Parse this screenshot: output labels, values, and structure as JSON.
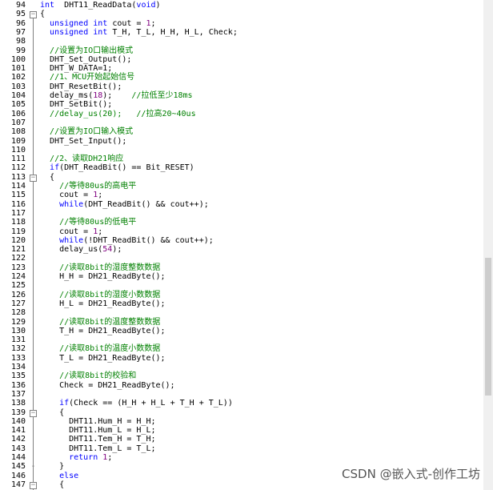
{
  "watermark": "CSDN @嵌入式-创作工坊",
  "lines": [
    {
      "n": "94",
      "fold": "",
      "t": [
        [
          "kw",
          "int"
        ],
        [
          "",
          "  DHT11_ReadData("
        ],
        [
          "kw",
          "void"
        ],
        [
          "",
          ")"
        ]
      ]
    },
    {
      "n": "95",
      "fold": "⊟",
      "t": [
        [
          "",
          "{"
        ]
      ]
    },
    {
      "n": "96",
      "fold": "",
      "t": [
        [
          "",
          "  "
        ],
        [
          "kw",
          "unsigned int"
        ],
        [
          "",
          " cout = "
        ],
        [
          "num",
          "1"
        ],
        [
          "",
          ";"
        ]
      ]
    },
    {
      "n": "97",
      "fold": "",
      "t": [
        [
          "",
          "  "
        ],
        [
          "kw",
          "unsigned int"
        ],
        [
          "",
          " T_H, T_L, H_H, H_L, Check;"
        ]
      ]
    },
    {
      "n": "98",
      "fold": "",
      "t": []
    },
    {
      "n": "99",
      "fold": "",
      "t": [
        [
          "",
          "  "
        ],
        [
          "cm",
          "//设置为IO口输出模式"
        ]
      ]
    },
    {
      "n": "100",
      "fold": "",
      "t": [
        [
          "",
          "  DHT_Set_Output();"
        ]
      ]
    },
    {
      "n": "101",
      "fold": "",
      "t": [
        [
          "",
          "  DHT_W_DATA=1;"
        ]
      ]
    },
    {
      "n": "102",
      "fold": "",
      "t": [
        [
          "",
          "  "
        ],
        [
          "cm",
          "//1、MCU开始起始信号"
        ]
      ]
    },
    {
      "n": "103",
      "fold": "",
      "t": [
        [
          "",
          "  DHT_ResetBit();"
        ]
      ]
    },
    {
      "n": "104",
      "fold": "",
      "t": [
        [
          "",
          "  delay_ms("
        ],
        [
          "num",
          "18"
        ],
        [
          "",
          ");    "
        ],
        [
          "cm",
          "//拉低至少18ms"
        ]
      ]
    },
    {
      "n": "105",
      "fold": "",
      "t": [
        [
          "",
          "  DHT_SetBit();"
        ]
      ]
    },
    {
      "n": "106",
      "fold": "",
      "t": [
        [
          "",
          "  "
        ],
        [
          "cm",
          "//delay_us(20);   //拉高20~40us"
        ]
      ]
    },
    {
      "n": "107",
      "fold": "",
      "t": []
    },
    {
      "n": "108",
      "fold": "",
      "t": [
        [
          "",
          "  "
        ],
        [
          "cm",
          "//设置为IO口输入模式"
        ]
      ]
    },
    {
      "n": "109",
      "fold": "",
      "t": [
        [
          "",
          "  DHT_Set_Input();"
        ]
      ]
    },
    {
      "n": "110",
      "fold": "",
      "t": []
    },
    {
      "n": "111",
      "fold": "",
      "t": [
        [
          "",
          "  "
        ],
        [
          "cm",
          "//2、读取DH21响应"
        ]
      ]
    },
    {
      "n": "112",
      "fold": "",
      "t": [
        [
          "",
          "  "
        ],
        [
          "kw",
          "if"
        ],
        [
          "",
          "(DHT_ReadBit() == Bit_RESET)"
        ]
      ]
    },
    {
      "n": "113",
      "fold": "⊟",
      "t": [
        [
          "",
          "  {"
        ]
      ]
    },
    {
      "n": "114",
      "fold": "",
      "t": [
        [
          "",
          "    "
        ],
        [
          "cm",
          "//等待80us的高电平"
        ]
      ]
    },
    {
      "n": "115",
      "fold": "",
      "t": [
        [
          "",
          "    cout = "
        ],
        [
          "num",
          "1"
        ],
        [
          "",
          ";"
        ]
      ]
    },
    {
      "n": "116",
      "fold": "",
      "t": [
        [
          "",
          "    "
        ],
        [
          "kw",
          "while"
        ],
        [
          "",
          "(DHT_ReadBit() && cout++);"
        ]
      ]
    },
    {
      "n": "117",
      "fold": "",
      "t": []
    },
    {
      "n": "118",
      "fold": "",
      "t": [
        [
          "",
          "    "
        ],
        [
          "cm",
          "//等待80us的低电平"
        ]
      ]
    },
    {
      "n": "119",
      "fold": "",
      "t": [
        [
          "",
          "    cout = "
        ],
        [
          "num",
          "1"
        ],
        [
          "",
          ";"
        ]
      ]
    },
    {
      "n": "120",
      "fold": "",
      "t": [
        [
          "",
          "    "
        ],
        [
          "kw",
          "while"
        ],
        [
          "",
          "(!DHT_ReadBit() && cout++);"
        ]
      ]
    },
    {
      "n": "121",
      "fold": "",
      "t": [
        [
          "",
          "    delay_us("
        ],
        [
          "num",
          "54"
        ],
        [
          "",
          ");"
        ]
      ]
    },
    {
      "n": "122",
      "fold": "",
      "t": []
    },
    {
      "n": "123",
      "fold": "",
      "t": [
        [
          "",
          "    "
        ],
        [
          "cm",
          "//读取8bit的湿度整数数据"
        ]
      ]
    },
    {
      "n": "124",
      "fold": "",
      "t": [
        [
          "",
          "    H_H = DH21_ReadByte();"
        ]
      ]
    },
    {
      "n": "125",
      "fold": "",
      "t": []
    },
    {
      "n": "126",
      "fold": "",
      "t": [
        [
          "",
          "    "
        ],
        [
          "cm",
          "//读取8bit的湿度小数数据"
        ]
      ]
    },
    {
      "n": "127",
      "fold": "",
      "t": [
        [
          "",
          "    H_L = DH21_ReadByte();"
        ]
      ]
    },
    {
      "n": "128",
      "fold": "",
      "t": []
    },
    {
      "n": "129",
      "fold": "",
      "t": [
        [
          "",
          "    "
        ],
        [
          "cm",
          "//读取8bit的温度整数数据"
        ]
      ]
    },
    {
      "n": "130",
      "fold": "",
      "t": [
        [
          "",
          "    T_H = DH21_ReadByte();"
        ]
      ]
    },
    {
      "n": "131",
      "fold": "",
      "t": []
    },
    {
      "n": "132",
      "fold": "",
      "t": [
        [
          "",
          "    "
        ],
        [
          "cm",
          "//读取8bit的温度小数数据"
        ]
      ]
    },
    {
      "n": "133",
      "fold": "",
      "t": [
        [
          "",
          "    T_L = DH21_ReadByte();"
        ]
      ]
    },
    {
      "n": "134",
      "fold": "",
      "t": []
    },
    {
      "n": "135",
      "fold": "",
      "t": [
        [
          "",
          "    "
        ],
        [
          "cm",
          "//读取8bit的校验和"
        ]
      ]
    },
    {
      "n": "136",
      "fold": "",
      "t": [
        [
          "",
          "    Check = DH21_ReadByte();"
        ]
      ]
    },
    {
      "n": "137",
      "fold": "",
      "t": []
    },
    {
      "n": "138",
      "fold": "",
      "t": [
        [
          "",
          "    "
        ],
        [
          "kw",
          "if"
        ],
        [
          "",
          "(Check == (H_H + H_L + T_H + T_L))"
        ]
      ]
    },
    {
      "n": "139",
      "fold": "⊟",
      "t": [
        [
          "",
          "    {"
        ]
      ]
    },
    {
      "n": "140",
      "fold": "",
      "t": [
        [
          "",
          "      DHT11.Hum_H = H_H;"
        ]
      ]
    },
    {
      "n": "141",
      "fold": "",
      "t": [
        [
          "",
          "      DHT11.Hum_L = H_L;"
        ]
      ]
    },
    {
      "n": "142",
      "fold": "",
      "t": [
        [
          "",
          "      DHT11.Tem_H = T_H;"
        ]
      ]
    },
    {
      "n": "143",
      "fold": "",
      "t": [
        [
          "",
          "      DHT11.Tem_L = T_L;"
        ]
      ]
    },
    {
      "n": "144",
      "fold": "",
      "t": [
        [
          "",
          "      "
        ],
        [
          "kw",
          "return"
        ],
        [
          "",
          " "
        ],
        [
          "num",
          "1"
        ],
        [
          "",
          ";"
        ]
      ]
    },
    {
      "n": "145",
      "fold": "-",
      "t": [
        [
          "",
          "    }"
        ]
      ]
    },
    {
      "n": "146",
      "fold": "",
      "t": [
        [
          "",
          "    "
        ],
        [
          "kw",
          "else"
        ]
      ]
    },
    {
      "n": "147",
      "fold": "⊟",
      "t": [
        [
          "",
          "    {"
        ]
      ]
    }
  ]
}
